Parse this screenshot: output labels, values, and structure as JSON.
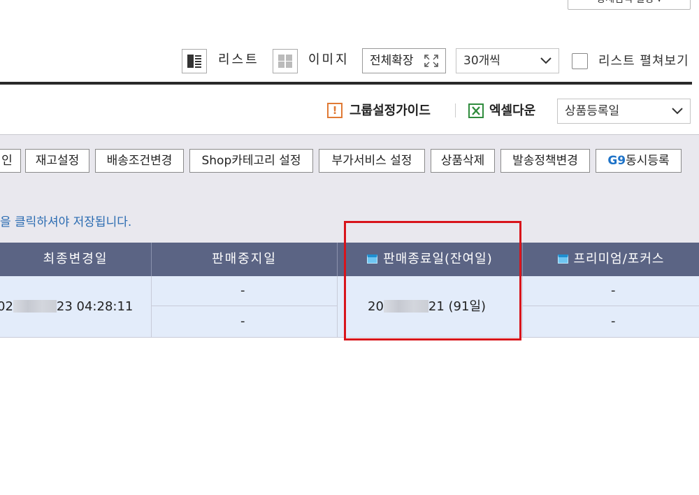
{
  "top_button": {
    "label": "상세검색 설정 ▾"
  },
  "view_toolbar": {
    "list_label": "리스트",
    "image_label": "이미지",
    "expand_label": "전체확장",
    "per_page": "30개씩",
    "unfold_label": "리스트 펼쳐보기"
  },
  "action_bar": {
    "guide_label": "그룹설정가이드",
    "excel_label": "엑셀다운",
    "sort_select": "상품등록일"
  },
  "buttons": {
    "partial": "인",
    "stock": "재고설정",
    "shipping": "배송조건변경",
    "shop_category": "Shop카테고리 설정",
    "extra_service": "부가서비스 설정",
    "delete": "상품삭제",
    "ship_policy": "발송정책변경",
    "g9_prefix": "G9",
    "g9_suffix": "동시등록"
  },
  "notice": "을 클릭하셔야 저장됩니다.",
  "table": {
    "headers": {
      "last_modified": "최종변경일",
      "sale_stop": "판매중지일",
      "sale_end": "판매종료일(잔여일)",
      "premium": "프리미엄/포커스"
    },
    "row": {
      "last_modified_prefix": "02",
      "last_modified_suffix": "23 04:28:11",
      "sale_stop_1": "-",
      "sale_stop_2": "-",
      "sale_end_prefix": "20",
      "sale_end_suffix": "21 (91일)",
      "premium_1": "-",
      "premium_2": "-"
    }
  },
  "colors": {
    "header_bg": "#5b6484",
    "row_bg": "#e3ecfa",
    "highlight": "#d8141b",
    "notice": "#2a6bb1"
  }
}
